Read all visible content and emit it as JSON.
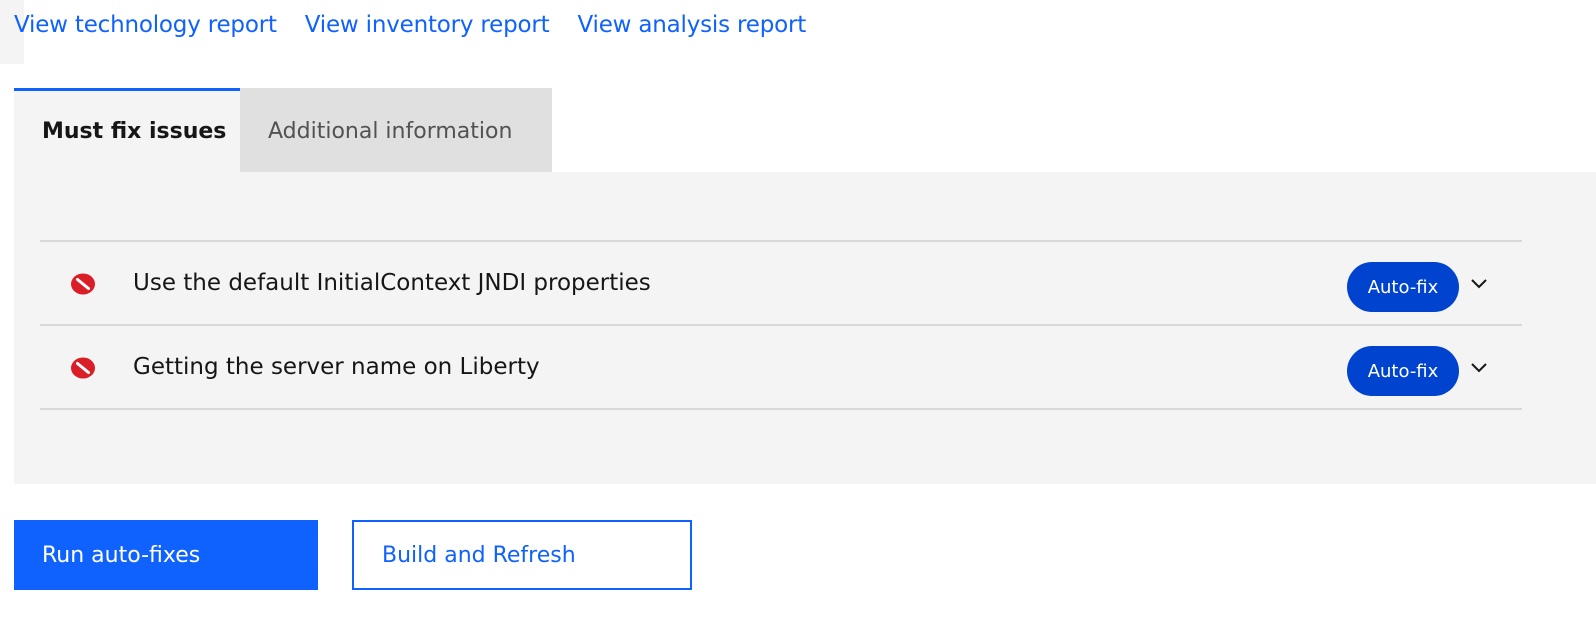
{
  "links": [
    {
      "label": "View technology report"
    },
    {
      "label": "View inventory report"
    },
    {
      "label": "View analysis report"
    }
  ],
  "tabs": [
    {
      "label": "Must fix issues",
      "active": true
    },
    {
      "label": "Additional information",
      "active": false
    }
  ],
  "issues": [
    {
      "title": "Use the default InitialContext JNDI properties",
      "badge": "Auto-fix",
      "icon": "error-icon"
    },
    {
      "title": "Getting the server name on Liberty",
      "badge": "Auto-fix",
      "icon": "error-icon"
    }
  ],
  "actions": {
    "run_label": "Run auto-fixes",
    "build_label": "Build and Refresh"
  },
  "colors": {
    "link": "#0f62fe",
    "primary": "#0f62fe",
    "badge": "#0043ce",
    "error": "#da1e28",
    "panel": "#f4f4f4"
  }
}
